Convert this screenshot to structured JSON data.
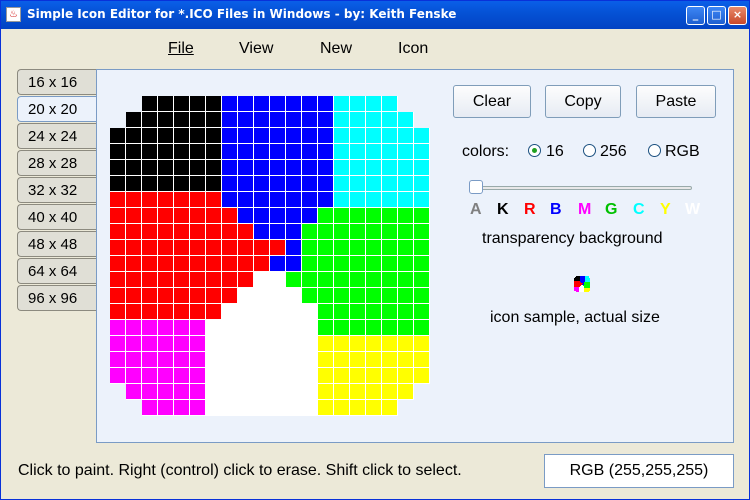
{
  "window": {
    "title": "Simple Icon Editor for *.ICO Files in Windows - by: Keith Fenske",
    "buttons": [
      "minimize",
      "maximize",
      "close"
    ]
  },
  "menu": [
    "File",
    "View",
    "New",
    "Icon"
  ],
  "tabs": [
    "16 x 16",
    "20 x 20",
    "24 x 24",
    "28 x 28",
    "32 x 32",
    "40 x 40",
    "48 x 48",
    "64 x 64",
    "96 x 96"
  ],
  "selected_tab": "20 x 20",
  "toolbar": {
    "clear": "Clear",
    "copy": "Copy",
    "paste": "Paste"
  },
  "colors": {
    "label": "colors:",
    "options": [
      "16",
      "256",
      "RGB"
    ],
    "selected": "16"
  },
  "transparency": {
    "letters": [
      {
        "t": "A",
        "c": "#808080"
      },
      {
        "t": "K",
        "c": "#000000"
      },
      {
        "t": "R",
        "c": "#ff0000"
      },
      {
        "t": "B",
        "c": "#0000ff"
      },
      {
        "t": "M",
        "c": "#ff00ff"
      },
      {
        "t": "G",
        "c": "#00c000"
      },
      {
        "t": "C",
        "c": "#00ffff"
      },
      {
        "t": "Y",
        "c": "#ffff00"
      },
      {
        "t": "W",
        "c": "#ffffff"
      }
    ],
    "caption": "transparency background"
  },
  "sample_caption": "icon sample, actual size",
  "status": "Click to paint.  Right (control) click to erase.  Shift click to select.",
  "rgb_readout": "RGB (255,255,255)",
  "palette": {
    "T": null,
    "K": "#000000",
    "B": "#0000ff",
    "C": "#00ffff",
    "R": "#ff0000",
    "G": "#00ff00",
    "W": "#ffffff",
    "M": "#ff00ff",
    "Y": "#ffff00"
  },
  "icon_pixels": [
    "..KKKKKBBBBBBBCCCC..",
    ".KKKKKKBBBBBBBCCCCC.",
    "KKKKKKKBBBBBBBCCCCCC",
    "KKKKKKKBBBBBBBCCCCCC",
    "KKKKKKKBBBBBBBCCCCCC",
    "KKKKKKKBBBBBBBCCCCCC",
    "RRRRRRRBBBBBBBCCCCCC",
    "RRRRRRRRBBBBBGGGGGGG",
    "RRRRRRRRRBBBGGGGGGGG",
    "RRRRRRRRRRRBGGGGGGGG",
    "RRRRRRRRRRBBGGGGGGGG",
    "RRRRRRRRRWWGGGGGGGGG",
    "RRRRRRRRWWWWGGGGGGGG",
    "RRRRRRRWWWWWWGGGGGGG",
    "MMMMMMWWWWWWWGGGGGGG",
    "MMMMMMWWWWWWWYYYYYYY",
    "MMMMMMWWWWWWWYYYYYYY",
    "MMMMMMWWWWWWWYYYYYYY",
    ".MMMMMWWWWWWWYYYYYY.",
    "..MMMMWWWWWWWYYYYY.."
  ]
}
